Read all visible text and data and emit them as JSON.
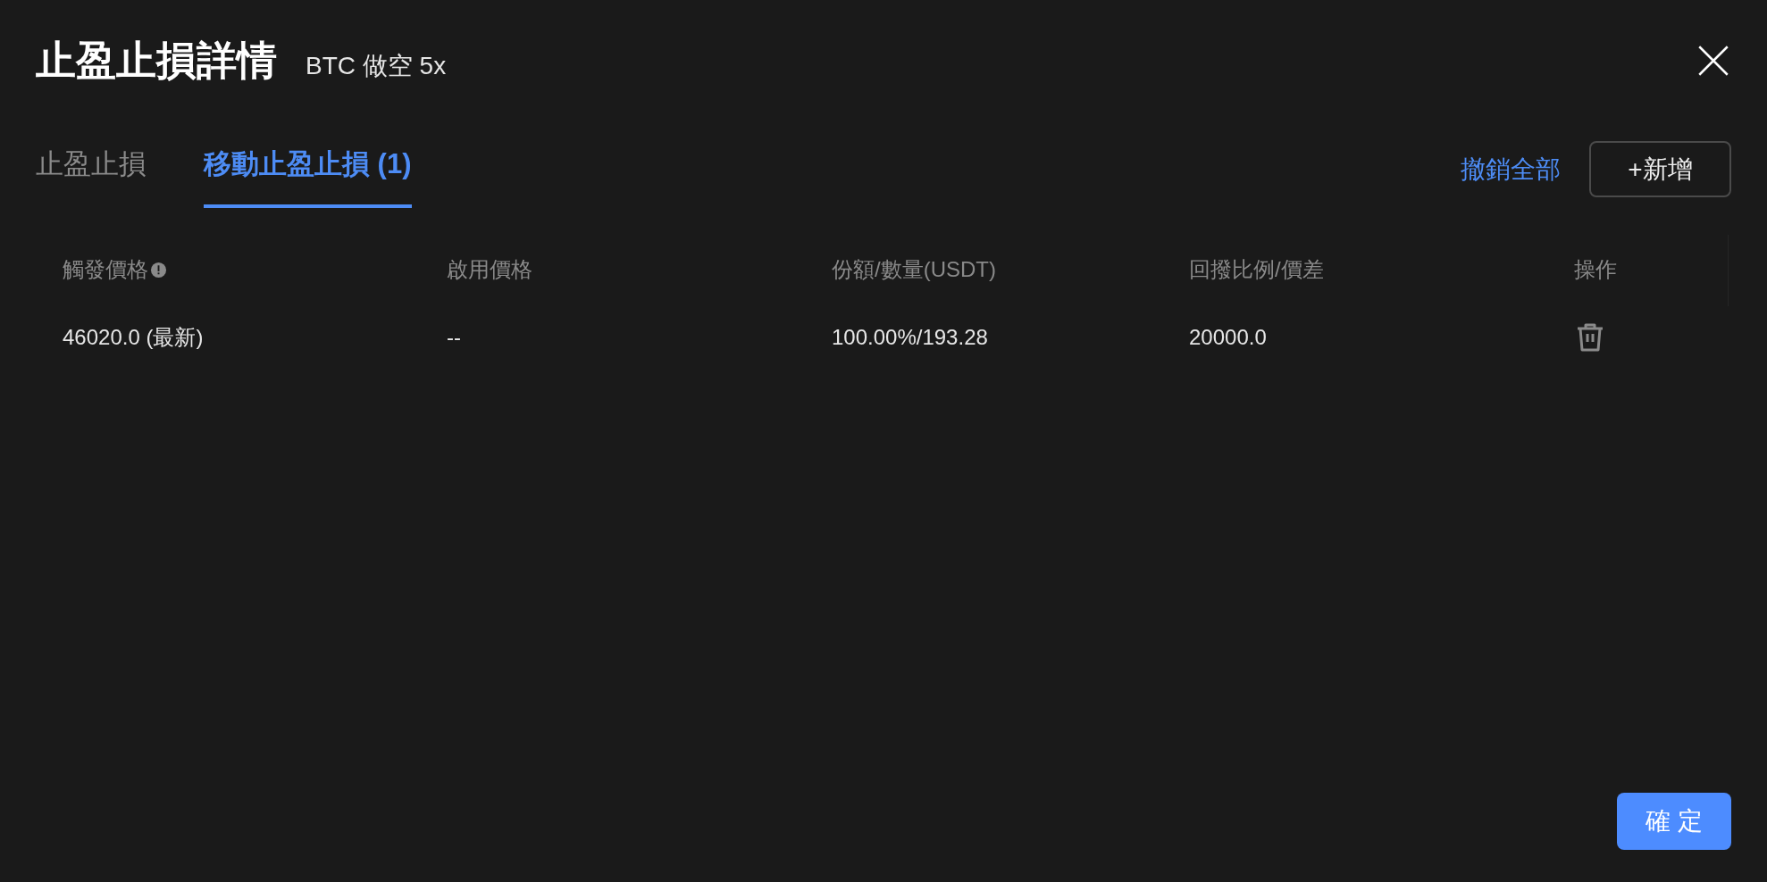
{
  "dialog": {
    "title": "止盈止損詳情",
    "subtitle": "BTC 做空 5x"
  },
  "tabs": [
    {
      "label": "止盈止損",
      "selected": false
    },
    {
      "label": "移動止盈止損 (1)",
      "selected": true
    }
  ],
  "actions": {
    "cancel_all": "撤銷全部",
    "add": "+新增"
  },
  "table": {
    "columns": [
      {
        "label": "觸發價格",
        "info": true
      },
      {
        "label": "啟用價格",
        "info": false
      },
      {
        "label": "份額/數量(USDT)",
        "info": false
      },
      {
        "label": "回撥比例/價差",
        "info": false
      },
      {
        "label": "操作",
        "info": false
      }
    ],
    "rows": [
      {
        "cells": [
          "46020.0 (最新)",
          "--",
          "100.00%/193.28",
          "20000.0"
        ]
      }
    ]
  },
  "confirm": "確定"
}
